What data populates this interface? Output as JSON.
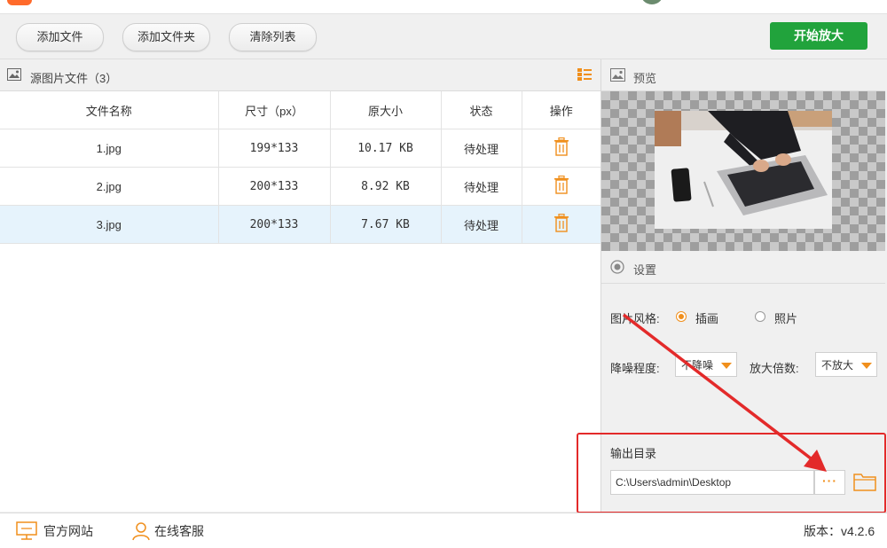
{
  "toolbar": {
    "add_file": "添加文件",
    "add_folder": "添加文件夹",
    "clear_list": "清除列表",
    "start": "开始放大"
  },
  "files_panel": {
    "title": "源图片文件（3）",
    "columns": [
      "文件名称",
      "尺寸（px）",
      "原大小",
      "状态",
      "操作"
    ],
    "rows": [
      {
        "name": "1.jpg",
        "size": "199*133",
        "filesize": "10.17 KB",
        "status": "待处理"
      },
      {
        "name": "2.jpg",
        "size": "200*133",
        "filesize": "8.92 KB",
        "status": "待处理"
      },
      {
        "name": "3.jpg",
        "size": "200*133",
        "filesize": "7.67 KB",
        "status": "待处理"
      }
    ]
  },
  "preview": {
    "title": "预览"
  },
  "settings": {
    "title": "设置",
    "style_label": "图片风格:",
    "style_options": [
      "插画",
      "照片"
    ],
    "style_selected": "插画",
    "noise_label": "降噪程度:",
    "noise_value": "不降噪",
    "scale_label": "放大倍数:",
    "scale_value": "不放大",
    "output_label": "输出目录",
    "output_path": "C:\\Users\\admin\\Desktop",
    "browse_label": "···"
  },
  "footer": {
    "website": "官方网站",
    "support": "在线客服",
    "version": "版本：v4.2.6"
  },
  "colors": {
    "accent": "#f08f1c",
    "start_button": "#21a33c",
    "selected_row": "#e6f3fc",
    "annotation": "#e32a2a"
  },
  "icons": [
    "image-icon",
    "grid-view-icon",
    "trash-icon",
    "preview-icon",
    "settings-radio-icon",
    "folder-icon",
    "monitor-icon",
    "person-icon"
  ]
}
